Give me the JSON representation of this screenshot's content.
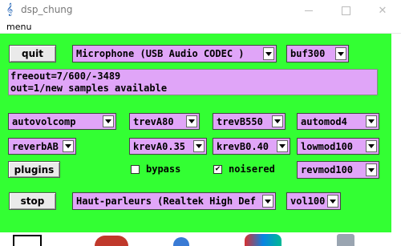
{
  "window": {
    "title": "dsp_chung"
  },
  "menu": {
    "label": "menu"
  },
  "buttons": {
    "quit": "quit",
    "plugins": "plugins",
    "stop": "stop"
  },
  "selects": {
    "input_device": "Microphone (USB Audio CODEC )",
    "buffer": "buf300",
    "autovolcomp": "autovolcomp",
    "treva": "trevA80",
    "trevb": "trevB550",
    "automod": "automod4",
    "reverb": "reverbAB",
    "kreva": "krevA0.35",
    "krevb": "krevB0.40",
    "lowmod": "lowmod100",
    "revmod": "revmod100",
    "output_device": "Haut-parleurs (Realtek High Def",
    "volume": "vol100"
  },
  "status": {
    "line1": "freeout=7/600/-3489",
    "line2": "out=1/new samples available"
  },
  "checkboxes": {
    "bypass": {
      "label": "bypass",
      "checked": false
    },
    "noiser": {
      "label": "noisered",
      "checked": true,
      "mark": "✔"
    }
  },
  "colors": {
    "panel": "#33ff33",
    "select": "#e0a5f8"
  }
}
